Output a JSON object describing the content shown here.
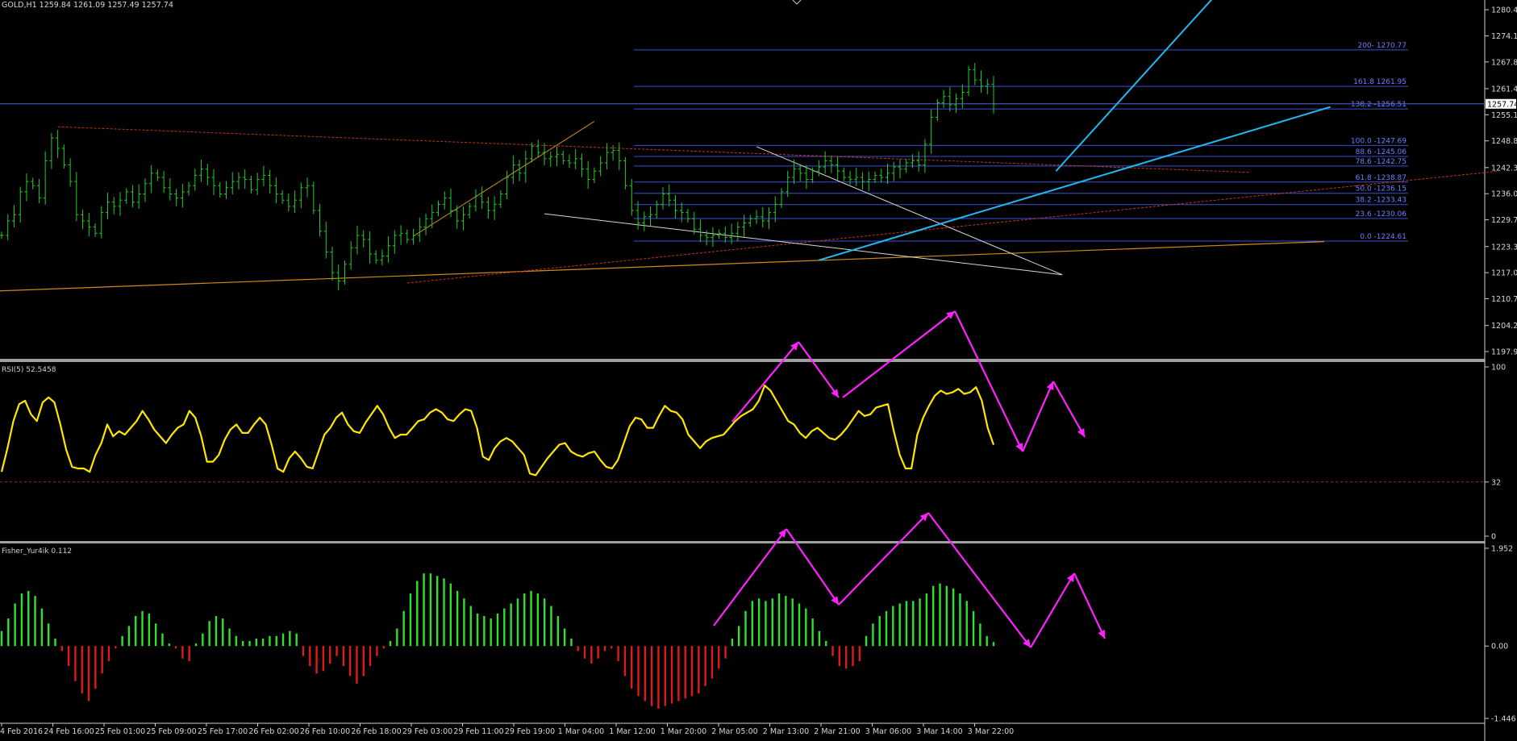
{
  "window": {
    "symbol_info": "GOLD,H1  1259.84 1261.09 1257.49 1257.74"
  },
  "colors": {
    "background": "#000000",
    "candles": "#22cc22",
    "rsi_line": "#ffe600",
    "fisher_positive": "#2fe02f",
    "fisher_negative": "#e01a1a",
    "annotation_arrows": "#ff22ff",
    "fib_lines": "#3a4fd6",
    "trend_cyan": "#21b8f0",
    "trend_orange": "#d08a1a",
    "trend_red_dotted": "#c8321e",
    "trend_white": "#d8d8d8",
    "axis_text": "#d8d8d8"
  },
  "chart_data": [
    {
      "type": "candlestick",
      "title": "GOLD,H1  1259.84 1261.09 1257.49 1257.74",
      "ylim": [
        1196.4,
        1282.8
      ],
      "ytick_labels": [
        "1280.45",
        "1274.15",
        "1267.85",
        "1261.40",
        "1255.10",
        "1248.80",
        "1242.35",
        "1236.05",
        "1229.75",
        "1223.30",
        "1217.00",
        "1210.70",
        "1204.25",
        "1197.95"
      ],
      "current_price_label": "1257.74",
      "x_tick_labels": [
        "4 Feb 2016",
        "24 Feb 16:00",
        "25 Feb 01:00",
        "25 Feb 09:00",
        "25 Feb 17:00",
        "26 Feb 02:00",
        "26 Feb 10:00",
        "26 Feb 18:00",
        "29 Feb 03:00",
        "29 Feb 11:00",
        "29 Feb 19:00",
        "1 Mar 04:00",
        "1 Mar 12:00",
        "1 Mar 20:00",
        "2 Mar 05:00",
        "2 Mar 13:00",
        "2 Mar 21:00",
        "3 Mar 06:00",
        "3 Mar 14:00",
        "3 Mar 22:00"
      ],
      "close_series": [
        1226.0,
        1229.5,
        1231.0,
        1236.5,
        1239.0,
        1238.0,
        1235.0,
        1244.0,
        1249.5,
        1247.0,
        1243.0,
        1239.0,
        1231.0,
        1229.5,
        1228.0,
        1226.5,
        1231.5,
        1234.0,
        1233.0,
        1234.5,
        1236.5,
        1234.0,
        1236.0,
        1238.5,
        1241.0,
        1240.0,
        1237.5,
        1236.0,
        1235.0,
        1236.5,
        1238.0,
        1240.5,
        1242.0,
        1240.0,
        1238.0,
        1236.0,
        1237.5,
        1239.0,
        1240.0,
        1239.5,
        1237.0,
        1239.5,
        1240.5,
        1238.0,
        1236.0,
        1234.5,
        1233.0,
        1234.5,
        1237.5,
        1238.0,
        1232.0,
        1227.0,
        1222.0,
        1217.0,
        1215.0,
        1219.0,
        1223.0,
        1226.0,
        1225.0,
        1221.5,
        1220.0,
        1221.0,
        1223.5,
        1226.0,
        1226.5,
        1225.0,
        1226.0,
        1228.0,
        1230.0,
        1231.5,
        1233.5,
        1235.0,
        1232.0,
        1229.5,
        1231.0,
        1233.0,
        1235.5,
        1234.0,
        1232.0,
        1233.5,
        1236.0,
        1240.0,
        1243.0,
        1241.0,
        1244.5,
        1247.5,
        1246.0,
        1244.5,
        1245.0,
        1245.5,
        1244.0,
        1243.5,
        1244.5,
        1242.0,
        1239.5,
        1241.5,
        1243.5,
        1246.0,
        1246.5,
        1244.0,
        1238.0,
        1232.0,
        1229.0,
        1230.5,
        1231.0,
        1233.5,
        1236.0,
        1234.5,
        1232.0,
        1231.5,
        1230.0,
        1227.5,
        1226.0,
        1225.5,
        1226.0,
        1226.5,
        1225.5,
        1226.5,
        1228.0,
        1229.0,
        1230.0,
        1230.5,
        1229.5,
        1231.5,
        1233.5,
        1236.5,
        1240.0,
        1242.0,
        1241.0,
        1239.5,
        1241.5,
        1242.5,
        1244.0,
        1243.0,
        1241.5,
        1240.0,
        1239.5,
        1240.0,
        1239.0,
        1239.5,
        1240.5,
        1240.0,
        1241.0,
        1242.5,
        1242.0,
        1243.5,
        1244.0,
        1243.0,
        1248.0,
        1254.5,
        1258.0,
        1259.5,
        1257.5,
        1259.0,
        1260.5,
        1266.0,
        1263.5,
        1262.0,
        1262.5,
        1257.7
      ],
      "fibonacci_levels": [
        {
          "label": "200- 1270.77",
          "value": 1270.77
        },
        {
          "label": "161.8 1261.95",
          "value": 1261.95
        },
        {
          "label": "138.2 -1256.51",
          "value": 1256.51
        },
        {
          "label": "100.0 -1247.69",
          "value": 1247.69
        },
        {
          "label": "88.6 -1245.06",
          "value": 1245.06
        },
        {
          "label": "78.6 -1242.75",
          "value": 1242.75
        },
        {
          "label": "61.8 -1238.87",
          "value": 1238.87
        },
        {
          "label": "50.0 -1236.15",
          "value": 1236.15
        },
        {
          "label": "38.2 -1233.43",
          "value": 1233.43
        },
        {
          "label": "23.6 -1230.06",
          "value": 1230.06
        },
        {
          "label": "0.0 -1224.61",
          "value": 1224.61
        }
      ],
      "horizontal_line_price": 1257.74
    },
    {
      "type": "line",
      "title": "RSI(5) 52.5458",
      "ylim": [
        0,
        100
      ],
      "ytick_labels": [
        "100",
        "32",
        "0"
      ],
      "level_line": 32,
      "values": [
        38,
        52,
        68,
        78,
        80,
        72,
        68,
        79,
        82,
        79,
        66,
        51,
        41,
        40,
        40,
        38,
        48,
        55,
        66,
        59,
        62,
        60,
        64,
        68,
        74,
        69,
        63,
        59,
        55,
        60,
        64,
        66,
        74,
        70,
        59,
        44,
        44,
        48,
        57,
        63,
        66,
        61,
        61,
        66,
        70,
        66,
        54,
        40,
        38,
        46,
        50,
        46,
        41,
        40,
        50,
        60,
        64,
        70,
        73,
        66,
        62,
        61,
        67,
        72,
        77,
        72,
        64,
        58,
        60,
        60,
        64,
        68,
        69,
        73,
        75,
        73,
        69,
        68,
        72,
        75,
        74,
        64,
        47,
        45,
        52,
        56,
        58,
        56,
        52,
        48,
        37,
        36,
        41,
        46,
        50,
        54,
        55,
        50,
        48,
        47,
        49,
        50,
        45,
        41,
        40,
        45,
        55,
        65,
        70,
        69,
        64,
        64,
        71,
        77,
        74,
        73,
        69,
        60,
        56,
        52,
        56,
        58,
        59,
        60,
        64,
        68,
        71,
        73,
        75,
        80,
        89,
        86,
        80,
        74,
        68,
        66,
        61,
        58,
        62,
        64,
        61,
        58,
        57,
        60,
        64,
        69,
        74,
        71,
        72,
        76,
        77,
        78,
        62,
        48,
        40,
        40,
        60,
        70,
        77,
        83,
        86,
        84,
        85,
        87,
        84,
        85,
        88,
        80,
        64,
        54
      ]
    },
    {
      "type": "bar",
      "title": "Fisher_Yur4ik 0.112",
      "ylim": [
        -1.446,
        1.952
      ],
      "ytick_labels": [
        "1.952",
        "0.00",
        "-1.446"
      ],
      "values": [
        0.3,
        0.55,
        0.85,
        1.05,
        1.1,
        1.0,
        0.75,
        0.45,
        0.15,
        -0.1,
        -0.4,
        -0.7,
        -0.95,
        -1.1,
        -0.85,
        -0.55,
        -0.3,
        -0.05,
        0.2,
        0.4,
        0.6,
        0.7,
        0.65,
        0.45,
        0.25,
        0.05,
        -0.05,
        -0.25,
        -0.3,
        0.05,
        0.25,
        0.5,
        0.6,
        0.55,
        0.35,
        0.2,
        0.1,
        0.1,
        0.15,
        0.15,
        0.2,
        0.2,
        0.25,
        0.3,
        0.25,
        -0.2,
        -0.4,
        -0.55,
        -0.5,
        -0.35,
        -0.2,
        -0.4,
        -0.6,
        -0.75,
        -0.6,
        -0.4,
        -0.2,
        -0.05,
        0.1,
        0.35,
        0.7,
        1.05,
        1.3,
        1.45,
        1.45,
        1.4,
        1.35,
        1.25,
        1.1,
        0.95,
        0.8,
        0.65,
        0.6,
        0.55,
        0.65,
        0.75,
        0.85,
        0.95,
        1.05,
        1.1,
        1.05,
        0.95,
        0.8,
        0.6,
        0.35,
        0.15,
        -0.1,
        -0.25,
        -0.35,
        -0.25,
        -0.1,
        -0.05,
        -0.3,
        -0.6,
        -0.85,
        -1.0,
        -1.1,
        -1.2,
        -1.25,
        -1.2,
        -1.15,
        -1.1,
        -1.05,
        -1.0,
        -0.95,
        -0.8,
        -0.65,
        -0.45,
        -0.25,
        0.15,
        0.4,
        0.7,
        0.9,
        0.95,
        0.9,
        0.95,
        1.05,
        1.0,
        0.95,
        0.85,
        0.75,
        0.55,
        0.3,
        0.1,
        -0.2,
        -0.4,
        -0.45,
        -0.4,
        -0.3,
        0.2,
        0.45,
        0.6,
        0.7,
        0.8,
        0.85,
        0.9,
        0.9,
        0.95,
        1.05,
        1.2,
        1.25,
        1.2,
        1.15,
        1.05,
        0.9,
        0.7,
        0.45,
        0.2,
        0.08
      ]
    }
  ]
}
